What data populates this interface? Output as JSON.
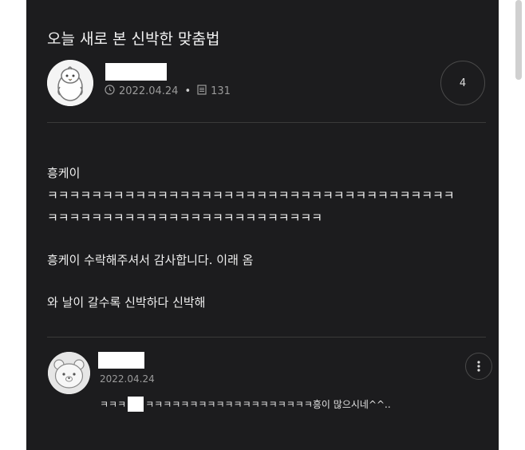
{
  "post": {
    "title": "오늘 새로 본 신박한 맞춤법",
    "date": "2022.04.24",
    "views": "131",
    "comment_count": "4",
    "body_lines": [
      "흥케이",
      "ㅋㅋㅋㅋㅋㅋㅋㅋㅋㅋㅋㅋㅋㅋㅋㅋㅋㅋㅋㅋㅋㅋㅋㅋㅋㅋㅋㅋㅋㅋㅋㅋㅋㅋㅋㅋㅋ",
      "ㅋㅋㅋㅋㅋㅋㅋㅋㅋㅋㅋㅋㅋㅋㅋㅋㅋㅋㅋㅋㅋㅋㅋㅋㅋ",
      "",
      "흥케이 수락해주셔서 감사합니다. 이래 옴",
      "",
      "와 날이 갈수록 신박하다 신박해"
    ]
  },
  "comment": {
    "date": "2022.04.24",
    "text_before": "ㅋㅋㅋ",
    "text_after": "ㅋㅋㅋㅋㅋㅋㅋㅋㅋㅋㅋㅋㅋㅋㅋㅋㅋㅋㅋ흥이 많으시네^^.."
  },
  "icons": {
    "clock": "clock-icon",
    "views": "document-icon",
    "more": "more-vertical-icon"
  },
  "colors": {
    "background": "#1c1c1e",
    "text": "#efefef",
    "muted": "#9a9a9a"
  }
}
